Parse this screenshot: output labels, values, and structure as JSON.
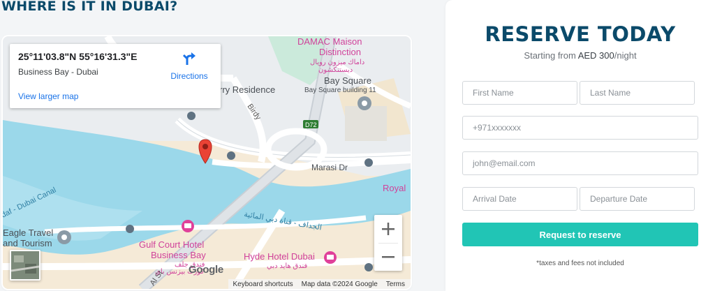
{
  "section": {
    "title": "WHERE IS IT IN DUBAI?"
  },
  "map": {
    "coordinates": "25°11'03.8\"N 55°16'31.3\"E",
    "address": "Business Bay - Dubai",
    "view_larger": "View larger map",
    "directions": "Directions",
    "labels": {
      "damac_en1": "DAMAC Maison",
      "damac_en2": "Distinction",
      "damac_ar1": "داماك ميزون رويال",
      "damac_ar2": "ديستنكشون",
      "residence": "rry Residence",
      "bay_square": "Bay Square",
      "bay_square_b11": "Bay Square building 11",
      "birdy": "Birdy",
      "d72": "D72",
      "marasi": "Marasi Dr",
      "royal": "Royal",
      "canal_en": "daf - Dubai Canal",
      "canal_ar": "الجداف - قناة دبي المائية",
      "eagle1": "Eagle Travel",
      "eagle2": "and Tourism",
      "gulf1": "Gulf Court Hotel",
      "gulf2": "Business Bay",
      "gulf_ar1": "فندق جلف",
      "gulf_ar2": "كورت بيزنس باي",
      "hyde": "Hyde Hotel Dubai",
      "hyde_ar": "فندق هايد دبي",
      "al_st": "Al St"
    },
    "zoom_in": "+",
    "zoom_out": "−",
    "google_logo": "Google",
    "footer": {
      "shortcuts": "Keyboard shortcuts",
      "mapdata": "Map data ©2024 Google",
      "terms": "Terms"
    }
  },
  "reserve": {
    "title": "RESERVE TODAY",
    "sub_prefix": "Starting from ",
    "price": "AED 300",
    "sub_suffix": "/night",
    "first_name": "First Name",
    "last_name": "Last Name",
    "phone": "+971xxxxxxx",
    "email": "john@email.com",
    "arrival": "Arrival Date",
    "departure": "Departure Date",
    "button": "Request to reserve",
    "note": "*taxes and fees not included"
  },
  "colors": {
    "heading": "#0b4a6a",
    "accent": "#21c5b5",
    "water": "#9bd8ea",
    "link": "#1a73e8",
    "poi_pink": "#e0409a"
  }
}
